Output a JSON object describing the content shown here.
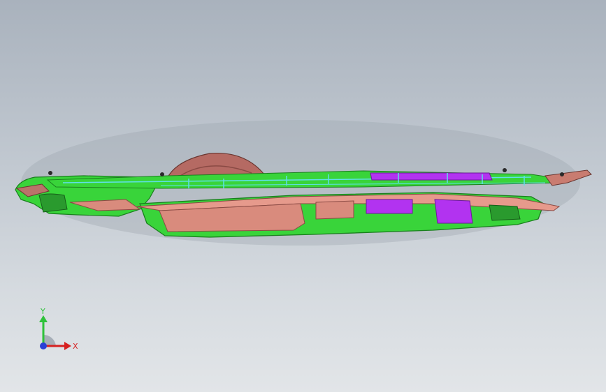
{
  "viewport": {
    "background_top": "#a9b2bd",
    "background_bottom": "#e2e5e8"
  },
  "model": {
    "colors": {
      "shell_green": "#39d43a",
      "shell_green_dark": "#1a7f1e",
      "copper": "#d98b7d",
      "copper_dark": "#8a4a44",
      "wheel": "#b56a63",
      "violet": "#b233f0",
      "cyan": "#5fe0e8"
    }
  },
  "triad": {
    "y_label": "Y",
    "x_label": "X",
    "y_color": "#2ec23a",
    "x_color": "#d62020",
    "z_color": "#2a3fd6"
  }
}
